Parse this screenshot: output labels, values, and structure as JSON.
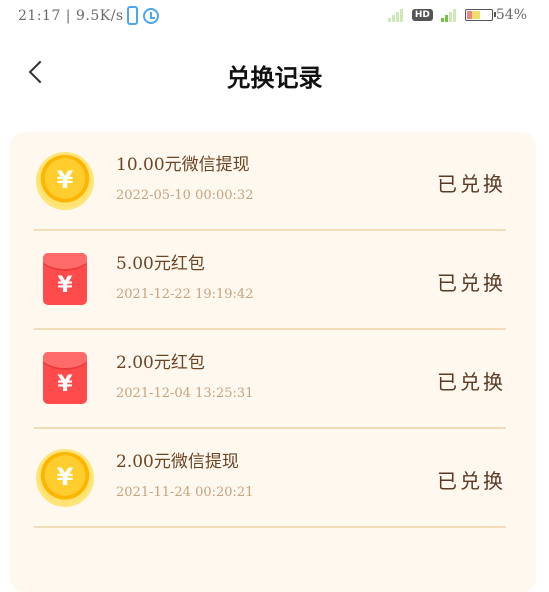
{
  "status_bar": {
    "time": "21:17",
    "network_speed": "9.5K/s",
    "battery_percent": "54%",
    "hd_label": "HD"
  },
  "header": {
    "title": "兑换记录"
  },
  "records": [
    {
      "icon": "coin-icon",
      "name": "10.00元微信提现",
      "time": "2022-05-10 00:00:32",
      "status": "已兑换"
    },
    {
      "icon": "red-packet-icon",
      "name": "5.00元红包",
      "time": "2021-12-22 19:19:42",
      "status": "已兑换"
    },
    {
      "icon": "red-packet-icon",
      "name": "2.00元红包",
      "time": "2021-12-04 13:25:31",
      "status": "已兑换"
    },
    {
      "icon": "coin-icon",
      "name": "2.00元微信提现",
      "time": "2021-11-24 00:20:21",
      "status": "已兑换"
    }
  ],
  "currency_symbol": "¥",
  "colors": {
    "card_bg": "#fff8ef",
    "divider": "#f4dcb9",
    "coin": "#ffb400",
    "red_packet": "#ff4b4b"
  }
}
